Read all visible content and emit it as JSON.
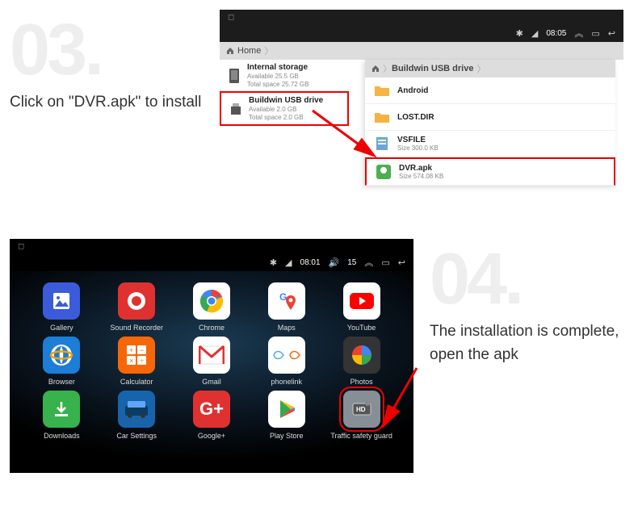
{
  "step3": {
    "number": "03.",
    "caption": "Click on  \"DVR.apk\" to install",
    "status": {
      "time": "08:05"
    },
    "left_panel": {
      "home": "Home",
      "storage": {
        "title": "Internal storage",
        "line1": "Available 25.5 GB",
        "line2": "Total space 25.72 GB"
      },
      "usb": {
        "title": "Buildwin USB drive",
        "line1": "Available 2.0 GB",
        "line2": "Total space 2.0 GB"
      }
    },
    "right_panel": {
      "breadcrumb": "Buildwin USB drive",
      "items": [
        {
          "title": "Android",
          "sub": "",
          "kind": "folder"
        },
        {
          "title": "LOST.DIR",
          "sub": "",
          "kind": "folder"
        },
        {
          "title": "VSFILE",
          "sub": "Size 300.0 KB",
          "kind": "file"
        },
        {
          "title": "DVR.apk",
          "sub": "Size 574.08 KB",
          "kind": "apk",
          "highlight": true
        }
      ]
    }
  },
  "step4": {
    "number": "04.",
    "caption": "The installation is complete, open the apk",
    "status": {
      "time": "08:01",
      "extra": "15"
    },
    "apps": [
      {
        "label": "Gallery",
        "icon": "gallery"
      },
      {
        "label": "Sound Recorder",
        "icon": "recorder"
      },
      {
        "label": "Chrome",
        "icon": "chrome"
      },
      {
        "label": "Maps",
        "icon": "maps"
      },
      {
        "label": "YouTube",
        "icon": "youtube"
      },
      {
        "label": "Browser",
        "icon": "browser"
      },
      {
        "label": "Calculator",
        "icon": "calc"
      },
      {
        "label": "Gmail",
        "icon": "gmail"
      },
      {
        "label": "phonelink",
        "icon": "phonelink"
      },
      {
        "label": "Photos",
        "icon": "photos"
      },
      {
        "label": "Downloads",
        "icon": "downloads"
      },
      {
        "label": "Car Settings",
        "icon": "carsettings"
      },
      {
        "label": "Google+",
        "icon": "gplus"
      },
      {
        "label": "Play Store",
        "icon": "playstore"
      },
      {
        "label": "Traffic safety guard",
        "icon": "traffic",
        "highlight": true
      }
    ]
  }
}
